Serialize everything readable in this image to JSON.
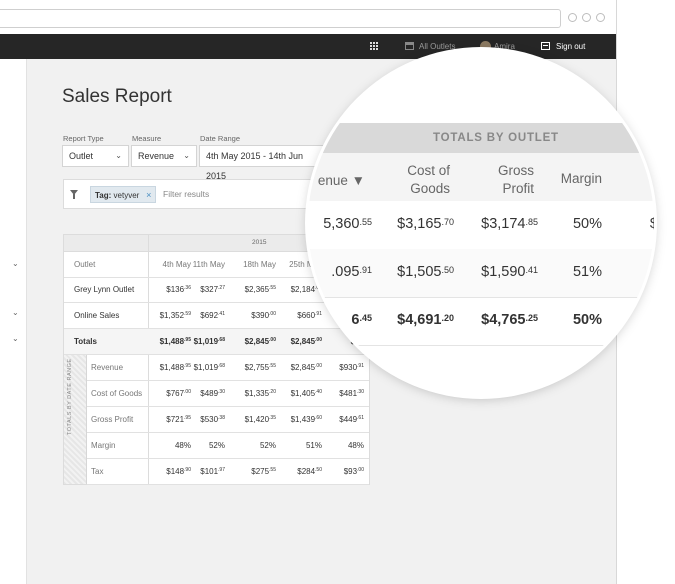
{
  "nav": {
    "all_outlets": "All Outlets",
    "user": "Amira",
    "sign_out": "Sign out"
  },
  "page": {
    "title": "Sales Report"
  },
  "filters": {
    "report_type": {
      "label": "Report Type",
      "value": "Outlet"
    },
    "measure": {
      "label": "Measure",
      "value": "Revenue"
    },
    "date_range": {
      "label": "Date Range",
      "value": "4th May 2015 - 14th Jun 2015"
    }
  },
  "filter_bar": {
    "tag_label": "Tag:",
    "tag_value": "vetyver",
    "tag_remove": "×",
    "placeholder": "Filter results"
  },
  "table": {
    "year": "2015",
    "outlet_header": "Outlet",
    "columns": [
      "4th May",
      "11th May",
      "18th May",
      "25th May"
    ],
    "rows": [
      {
        "label": "Grey Lynn Outlet",
        "cells": [
          [
            "$136",
            ".36"
          ],
          [
            "$327",
            ".27"
          ],
          [
            "$2,365",
            ".55"
          ],
          [
            "$2,184",
            ".09"
          ]
        ]
      },
      {
        "label": "Online Sales",
        "cells": [
          [
            "$1,352",
            ".59"
          ],
          [
            "$692",
            ".41"
          ],
          [
            "$390",
            ".00"
          ],
          [
            "$660",
            ".91"
          ]
        ]
      },
      {
        "label": "Totals",
        "cells": [
          [
            "$1,488",
            ".95"
          ],
          [
            "$1,019",
            ".68"
          ],
          [
            "$2,845",
            ".00"
          ],
          [
            "$2,845",
            ".00"
          ],
          [
            "$93",
            ""
          ]
        ]
      }
    ],
    "side_label": "TOTALS BY DATE RANGE",
    "summary": [
      {
        "label": "Revenue",
        "cells": [
          [
            "$1,488",
            ".95"
          ],
          [
            "$1,019",
            ".68"
          ],
          [
            "$2,755",
            ".55"
          ],
          [
            "$2,845",
            ".00"
          ],
          [
            "$930",
            ".91"
          ]
        ]
      },
      {
        "label": "Cost of Goods",
        "cells": [
          [
            "$767",
            ".00"
          ],
          [
            "$489",
            ".30"
          ],
          [
            "$1,335",
            ".20"
          ],
          [
            "$1,405",
            ".40"
          ],
          [
            "$481",
            ".30"
          ]
        ]
      },
      {
        "label": "Gross Profit",
        "cells": [
          [
            "$721",
            ".95"
          ],
          [
            "$530",
            ".38"
          ],
          [
            "$1,420",
            ".35"
          ],
          [
            "$1,439",
            ".60"
          ],
          [
            "$449",
            ".61"
          ]
        ]
      },
      {
        "label": "Margin",
        "cells": [
          [
            "48%",
            ""
          ],
          [
            "52%",
            ""
          ],
          [
            "52%",
            ""
          ],
          [
            "51%",
            ""
          ],
          [
            "48%",
            ""
          ]
        ]
      },
      {
        "label": "Tax",
        "cells": [
          [
            "$148",
            ".90"
          ],
          [
            "$101",
            ".97"
          ],
          [
            "$275",
            ".55"
          ],
          [
            "$284",
            ".50"
          ],
          [
            "$93",
            ".00"
          ]
        ]
      }
    ]
  },
  "magnifier": {
    "title": "TOTALS BY OUTLET",
    "headers": [
      "enue ▼",
      "Cost of\nGoods",
      "Gross\nProfit",
      "Margin"
    ],
    "rows": [
      [
        [
          "5,360",
          ".55"
        ],
        [
          "$3,165",
          ".70"
        ],
        [
          "$3,174",
          ".85"
        ],
        [
          "50%",
          ""
        ],
        [
          "$6",
          ""
        ]
      ],
      [
        [
          ".095",
          ".91"
        ],
        [
          "$1,505",
          ".50"
        ],
        [
          "$1,590",
          ".41"
        ],
        [
          "51%",
          ""
        ],
        [
          "$",
          ""
        ]
      ],
      [
        [
          "6",
          ".45"
        ],
        [
          "$4,691",
          ".20"
        ],
        [
          "$4,765",
          ".25"
        ],
        [
          "50%",
          ""
        ],
        [
          "",
          ""
        ]
      ]
    ]
  }
}
